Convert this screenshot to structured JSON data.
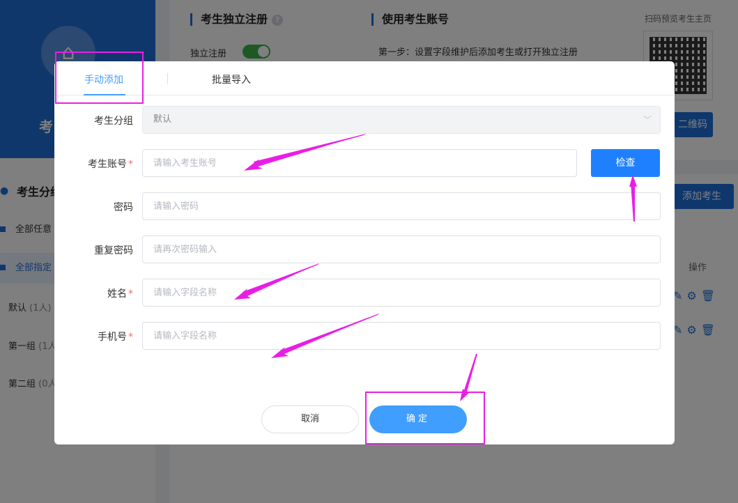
{
  "background": {
    "profile_name": "考",
    "group_title": "考生分组",
    "group_items": [
      {
        "label": "全部任意"
      },
      {
        "label": "全部指定"
      }
    ],
    "group_plain": [
      {
        "label": "默认",
        "count": "(1人)"
      },
      {
        "label": "第一组",
        "count": "(1人"
      },
      {
        "label": "第二组",
        "count": "(0人"
      }
    ],
    "register_title": "考生独立注册",
    "help": "?",
    "switch_label": "独立注册",
    "account_title": "使用考生账号",
    "step_text": "第一步：设置字段维护后添加考生或打开独立注册",
    "scan_text": "扫码预览考生主页",
    "qr_button": "二维码",
    "add_button": "添加考生",
    "ops_header": "操作"
  },
  "dialog": {
    "tabs": [
      {
        "label": "手动添加",
        "active": true
      },
      {
        "label": "批量导入",
        "active": false
      }
    ],
    "fields": {
      "group": {
        "label": "考生分组",
        "value": "默认"
      },
      "account": {
        "label": "考生账号",
        "required": "*",
        "placeholder": "请输入考生账号"
      },
      "password": {
        "label": "密码",
        "placeholder": "请输入密码"
      },
      "repeat_password": {
        "label": "重复密码",
        "placeholder": "请再次密码输入"
      },
      "name": {
        "label": "姓名",
        "required": "*",
        "placeholder": "请输入字段名称"
      },
      "phone": {
        "label": "手机号",
        "required": "*",
        "placeholder": "请输入字段名称"
      }
    },
    "check_button": "检查",
    "cancel_button": "取消",
    "ok_button": "确定"
  },
  "colors": {
    "primary": "#409eff",
    "check_blue": "#1e80ff",
    "annotation": "#e91ee6",
    "required": "#f56c6c"
  }
}
